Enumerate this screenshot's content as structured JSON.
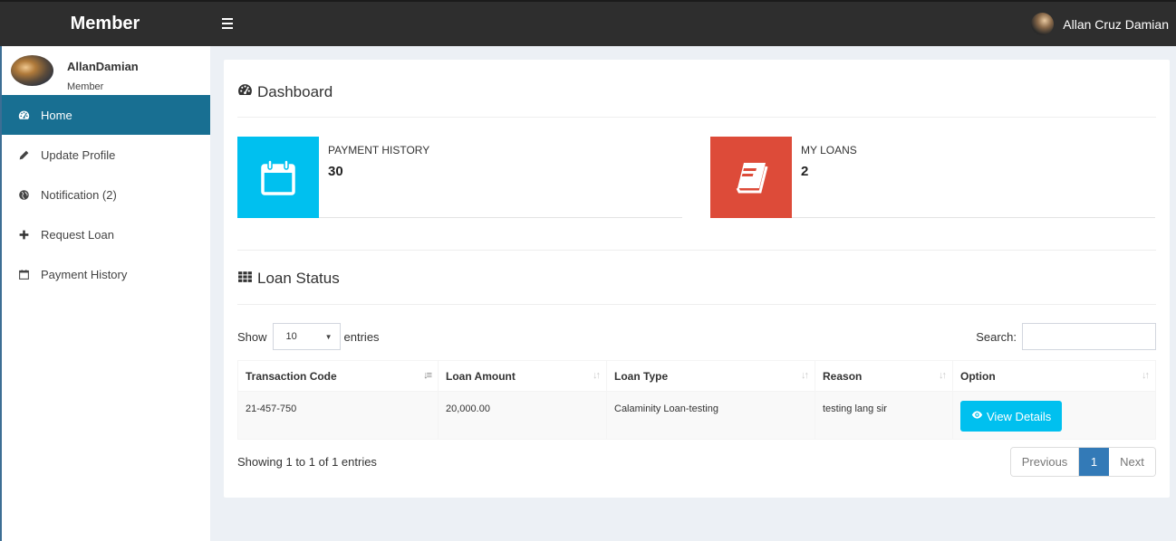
{
  "header": {
    "brand": "Member",
    "user_name": "Allan Cruz Damian"
  },
  "sidebar": {
    "user": {
      "name": "AllanDamian",
      "role": "Member"
    },
    "items": [
      {
        "label": "Home",
        "icon": "dashboard-icon",
        "active": true
      },
      {
        "label": "Update Profile",
        "icon": "pencil-icon",
        "active": false
      },
      {
        "label": "Notification (2)",
        "icon": "globe-icon",
        "active": false
      },
      {
        "label": "Request Loan",
        "icon": "plus-icon",
        "active": false
      },
      {
        "label": "Payment History",
        "icon": "calendar-icon",
        "active": false
      }
    ]
  },
  "dashboard": {
    "title": "Dashboard",
    "boxes": [
      {
        "label": "PAYMENT HISTORY",
        "value": "30",
        "color": "#00c0ef",
        "icon": "calendar-icon"
      },
      {
        "label": "MY LOANS",
        "value": "2",
        "color": "#dd4b39",
        "icon": "book-icon"
      }
    ]
  },
  "loan_status": {
    "title": "Loan Status",
    "length": {
      "show_label": "Show",
      "selected": "10",
      "entries_label": "entries"
    },
    "search": {
      "label": "Search:",
      "value": "",
      "placeholder": ""
    },
    "columns": [
      "Transaction Code",
      "Loan Amount",
      "Loan Type",
      "Reason",
      "Option"
    ],
    "rows": [
      {
        "code": "21-457-750",
        "amount": "20,000.00",
        "type": "Calaminity Loan-testing",
        "reason": "testing lang sir",
        "action": "View Details"
      }
    ],
    "info": "Showing 1 to 1 of 1 entries",
    "pagination": {
      "previous": "Previous",
      "current": "1",
      "next": "Next"
    }
  },
  "colors": {
    "header_bg": "#2e2e2e",
    "sidebar_active": "#186f92",
    "info_aqua": "#00c0ef",
    "info_red": "#dd4b39",
    "page_active": "#337ab7"
  }
}
